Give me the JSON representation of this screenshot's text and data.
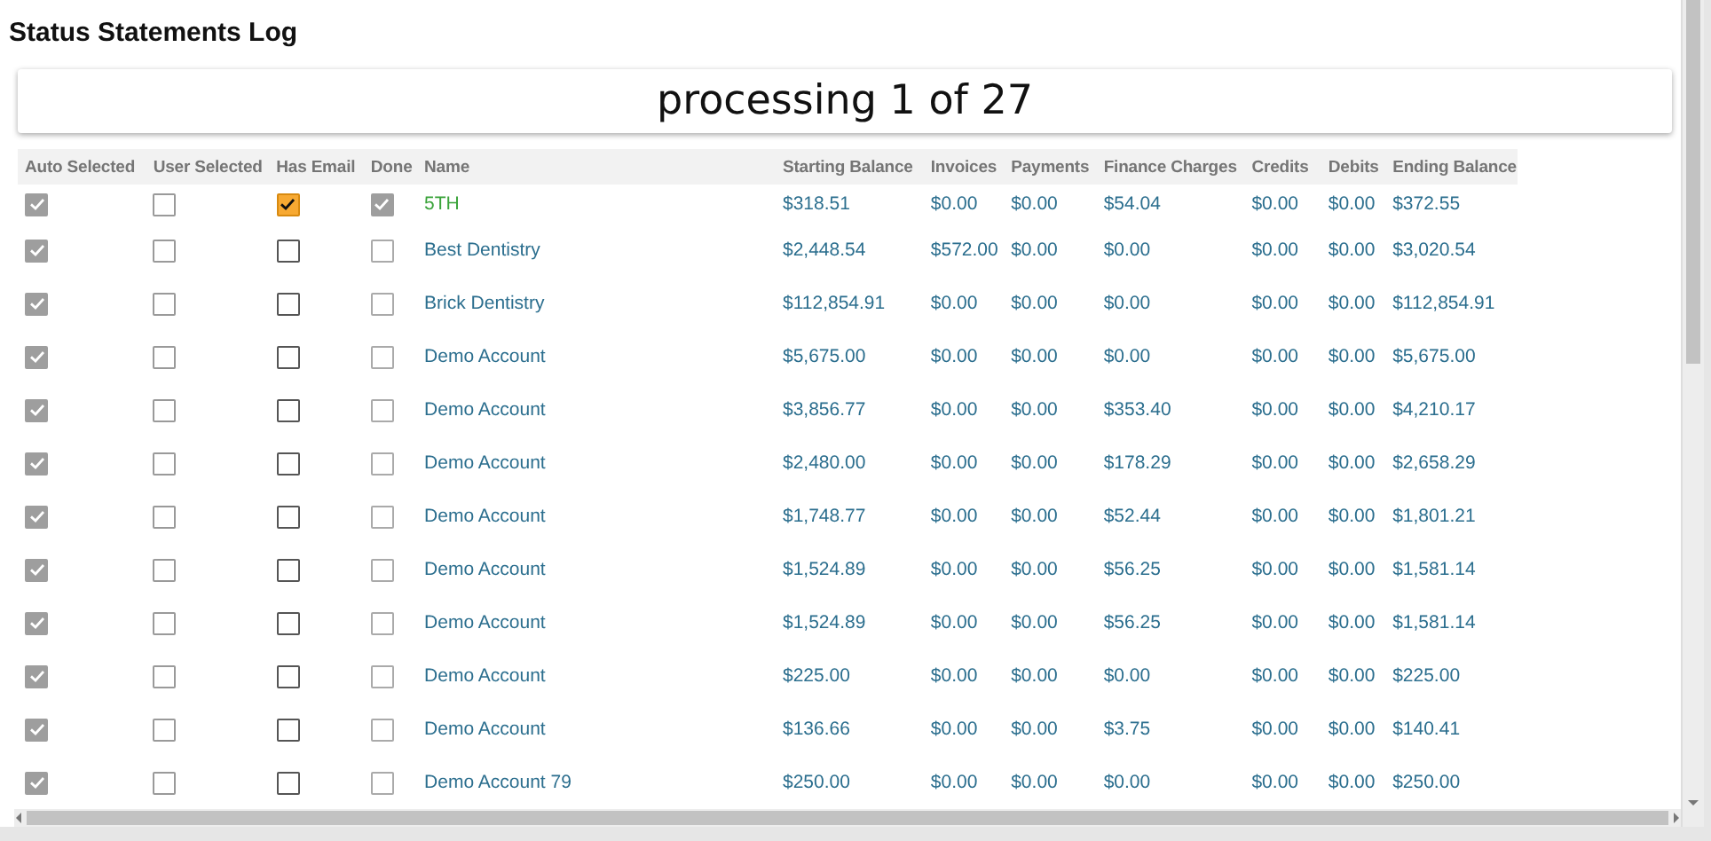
{
  "dialog": {
    "title": "Status Statements Log",
    "progress": "processing 1 of 27"
  },
  "table": {
    "columns": [
      "Auto Selected",
      "User Selected",
      "Has Email",
      "Done",
      "Name",
      "Starting Balance",
      "Invoices",
      "Payments",
      "Finance Charges",
      "Credits",
      "Debits",
      "Ending Balance"
    ],
    "rows": [
      {
        "auto_selected": true,
        "user_selected": false,
        "has_email": true,
        "done": true,
        "current": true,
        "name": "5TH",
        "amounts": [
          "$318.51",
          "$0.00",
          "$0.00",
          "$54.04",
          "$0.00",
          "$0.00",
          "$372.55"
        ]
      },
      {
        "auto_selected": true,
        "user_selected": false,
        "has_email": false,
        "done": false,
        "current": false,
        "name": "Best Dentistry",
        "amounts": [
          "$2,448.54",
          "$572.00",
          "$0.00",
          "$0.00",
          "$0.00",
          "$0.00",
          "$3,020.54"
        ]
      },
      {
        "auto_selected": true,
        "user_selected": false,
        "has_email": false,
        "done": false,
        "current": false,
        "name": "Brick Dentistry",
        "amounts": [
          "$112,854.91",
          "$0.00",
          "$0.00",
          "$0.00",
          "$0.00",
          "$0.00",
          "$112,854.91"
        ]
      },
      {
        "auto_selected": true,
        "user_selected": false,
        "has_email": false,
        "done": false,
        "current": false,
        "name": "Demo Account",
        "amounts": [
          "$5,675.00",
          "$0.00",
          "$0.00",
          "$0.00",
          "$0.00",
          "$0.00",
          "$5,675.00"
        ]
      },
      {
        "auto_selected": true,
        "user_selected": false,
        "has_email": false,
        "done": false,
        "current": false,
        "name": "Demo Account",
        "amounts": [
          "$3,856.77",
          "$0.00",
          "$0.00",
          "$353.40",
          "$0.00",
          "$0.00",
          "$4,210.17"
        ]
      },
      {
        "auto_selected": true,
        "user_selected": false,
        "has_email": false,
        "done": false,
        "current": false,
        "name": "Demo Account",
        "amounts": [
          "$2,480.00",
          "$0.00",
          "$0.00",
          "$178.29",
          "$0.00",
          "$0.00",
          "$2,658.29"
        ]
      },
      {
        "auto_selected": true,
        "user_selected": false,
        "has_email": false,
        "done": false,
        "current": false,
        "name": "Demo Account",
        "amounts": [
          "$1,748.77",
          "$0.00",
          "$0.00",
          "$52.44",
          "$0.00",
          "$0.00",
          "$1,801.21"
        ]
      },
      {
        "auto_selected": true,
        "user_selected": false,
        "has_email": false,
        "done": false,
        "current": false,
        "name": "Demo Account",
        "amounts": [
          "$1,524.89",
          "$0.00",
          "$0.00",
          "$56.25",
          "$0.00",
          "$0.00",
          "$1,581.14"
        ]
      },
      {
        "auto_selected": true,
        "user_selected": false,
        "has_email": false,
        "done": false,
        "current": false,
        "name": "Demo Account",
        "amounts": [
          "$1,524.89",
          "$0.00",
          "$0.00",
          "$56.25",
          "$0.00",
          "$0.00",
          "$1,581.14"
        ]
      },
      {
        "auto_selected": true,
        "user_selected": false,
        "has_email": false,
        "done": false,
        "current": false,
        "name": "Demo Account",
        "amounts": [
          "$225.00",
          "$0.00",
          "$0.00",
          "$0.00",
          "$0.00",
          "$0.00",
          "$225.00"
        ]
      },
      {
        "auto_selected": true,
        "user_selected": false,
        "has_email": false,
        "done": false,
        "current": false,
        "name": "Demo Account",
        "amounts": [
          "$136.66",
          "$0.00",
          "$0.00",
          "$3.75",
          "$0.00",
          "$0.00",
          "$140.41"
        ]
      },
      {
        "auto_selected": true,
        "user_selected": false,
        "has_email": false,
        "done": false,
        "current": false,
        "name": "Demo Account 79",
        "amounts": [
          "$250.00",
          "$0.00",
          "$0.00",
          "$0.00",
          "$0.00",
          "$0.00",
          "$250.00"
        ]
      }
    ]
  }
}
